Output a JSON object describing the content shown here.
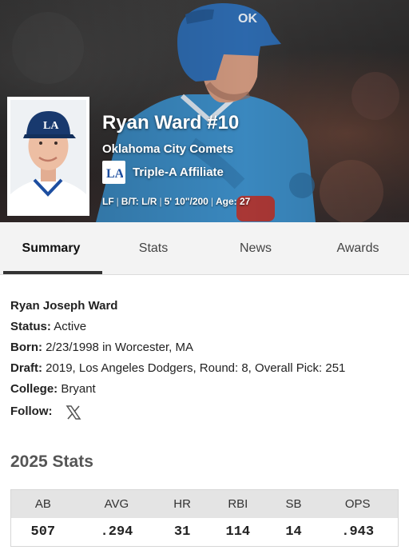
{
  "hero": {
    "player_name": "Ryan Ward #10",
    "team": "Oklahoma City Comets",
    "affiliate": "Triple-A Affiliate",
    "bio": {
      "position": "LF",
      "bats_throws": "B/T: L/R",
      "height_weight": "5' 10\"/200",
      "age": "Age: 27"
    },
    "colors": {
      "jersey": "#3d8fc9",
      "helmet": "#2f6eb5"
    }
  },
  "tabs": [
    {
      "label": "Summary",
      "active": true
    },
    {
      "label": "Stats",
      "active": false
    },
    {
      "label": "News",
      "active": false
    },
    {
      "label": "Awards",
      "active": false
    }
  ],
  "summary": {
    "full_name": "Ryan Joseph Ward",
    "status_label": "Status:",
    "status_value": "Active",
    "born_label": "Born:",
    "born_value": "2/23/1998 in Worcester, MA",
    "draft_label": "Draft:",
    "draft_value": "2019, Los Angeles Dodgers, Round: 8, Overall Pick: 251",
    "college_label": "College:",
    "college_value": "Bryant",
    "follow_label": "Follow:",
    "follow_icon": "x-icon"
  },
  "season_stats": {
    "title": "2025 Stats",
    "headers": [
      "AB",
      "AVG",
      "HR",
      "RBI",
      "SB",
      "OPS"
    ],
    "values": [
      "507",
      ".294",
      "31",
      "114",
      "14",
      ".943"
    ]
  }
}
